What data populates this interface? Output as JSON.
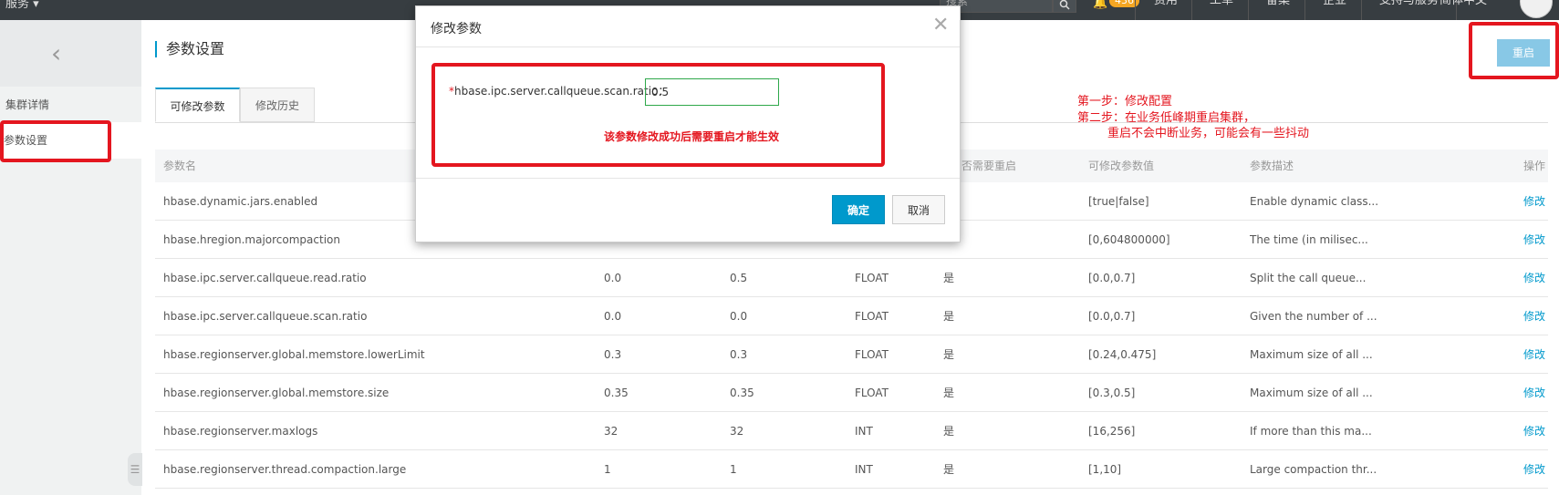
{
  "topbar": {
    "service_menu": "服务 ▾",
    "search_placeholder": "搜索",
    "notification_count": "436",
    "nav": [
      "费用",
      "工单",
      "备案",
      "企业",
      "支持与服务",
      "简体中文"
    ]
  },
  "sidebar": {
    "items": [
      {
        "label": "集群详情"
      },
      {
        "label": "参数设置"
      }
    ]
  },
  "page": {
    "title": "参数设置",
    "restart_label": "重启",
    "tabs": [
      {
        "label": "可修改参数"
      },
      {
        "label": "修改历史"
      }
    ]
  },
  "annotation": {
    "line1": "第一步：修改配置",
    "line2": "第二步：在业务低峰期重启集群，",
    "line3": "        重启不会中断业务，可能会有一些抖动"
  },
  "table": {
    "headers": [
      "参数名",
      "",
      "",
      "",
      "否需要重启",
      "可修改参数值",
      "参数描述",
      "操作"
    ],
    "rows": [
      {
        "name": "hbase.dynamic.jars.enabled",
        "default": "",
        "current": "",
        "type": "",
        "restart": "",
        "range": "[true|false]",
        "desc": "Enable dynamic class...",
        "action": "修改"
      },
      {
        "name": "hbase.hregion.majorcompaction",
        "default": "",
        "current": "",
        "type": "",
        "restart": "",
        "range": "[0,604800000]",
        "desc": "The time (in milisec...",
        "action": "修改"
      },
      {
        "name": "hbase.ipc.server.callqueue.read.ratio",
        "default": "0.0",
        "current": "0.5",
        "type": "FLOAT",
        "restart": "是",
        "range": "[0.0,0.7]",
        "desc": "Split the call queue...",
        "action": "修改"
      },
      {
        "name": "hbase.ipc.server.callqueue.scan.ratio",
        "default": "0.0",
        "current": "0.0",
        "type": "FLOAT",
        "restart": "是",
        "range": "[0.0,0.7]",
        "desc": "Given the number of ...",
        "action": "修改"
      },
      {
        "name": "hbase.regionserver.global.memstore.lowerLimit",
        "default": "0.3",
        "current": "0.3",
        "type": "FLOAT",
        "restart": "是",
        "range": "[0.24,0.475]",
        "desc": "Maximum size of all ...",
        "action": "修改"
      },
      {
        "name": "hbase.regionserver.global.memstore.size",
        "default": "0.35",
        "current": "0.35",
        "type": "FLOAT",
        "restart": "是",
        "range": "[0.3,0.5]",
        "desc": "Maximum size of all ...",
        "action": "修改"
      },
      {
        "name": "hbase.regionserver.maxlogs",
        "default": "32",
        "current": "32",
        "type": "INT",
        "restart": "是",
        "range": "[16,256]",
        "desc": "If more than this ma...",
        "action": "修改"
      },
      {
        "name": "hbase.regionserver.thread.compaction.large",
        "default": "1",
        "current": "1",
        "type": "INT",
        "restart": "是",
        "range": "[1,10]",
        "desc": "Large compaction thr...",
        "action": "修改"
      }
    ]
  },
  "modal": {
    "title": "修改参数",
    "field_label": "hbase.ipc.server.callqueue.scan.ratio：",
    "field_required": "*",
    "field_value": "0.5",
    "warning": "该参数修改成功后需要重启才能生效",
    "ok_label": "确定",
    "cancel_label": "取消"
  },
  "colors": {
    "accent": "#0099cc",
    "annotation_red": "#e4161f",
    "topbar_bg": "#373d41"
  }
}
